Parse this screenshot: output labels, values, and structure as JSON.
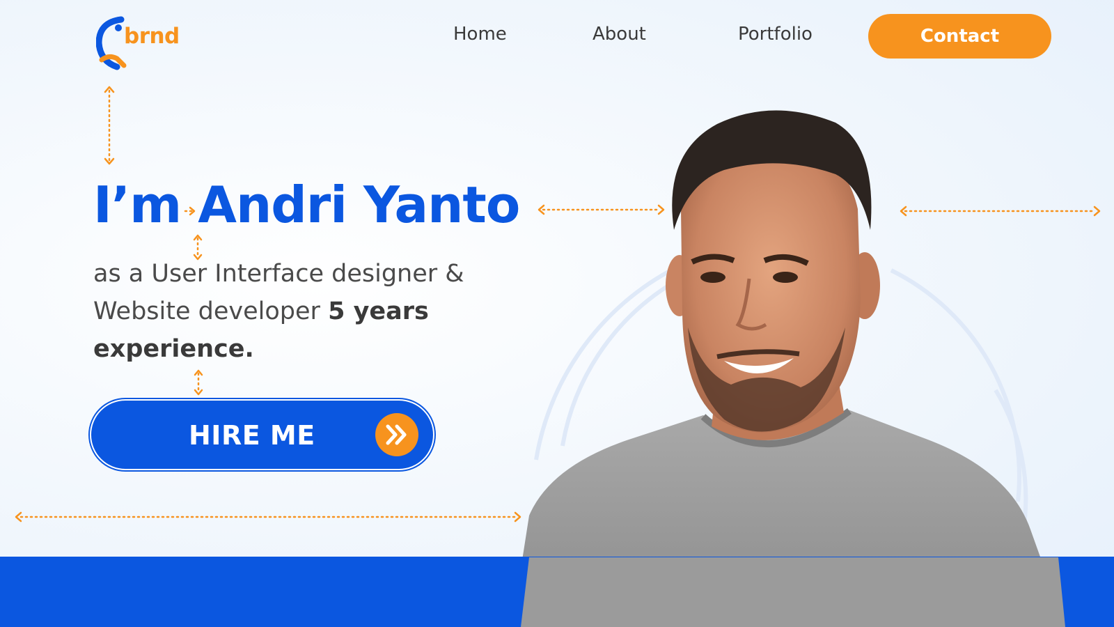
{
  "logo": {
    "text": "brnd",
    "icon": "hands-circle-logo-icon"
  },
  "nav": {
    "home": "Home",
    "about": "About",
    "portfolio": "Portfolio",
    "contact": "Contact"
  },
  "hero": {
    "intro": "I’m",
    "name": "Andri Yanto",
    "line1": "as a User Interface designer &",
    "line2": "Website developer",
    "highlight1": "5 years",
    "highlight2": "experience.",
    "cta": "HIRE ME",
    "cta_icon": "double-chevron-right-icon"
  },
  "colors": {
    "brand_blue": "#0b57e0",
    "accent_orange": "#f7931e",
    "text_dark": "#3a3a3a",
    "background": "#eef5fc"
  }
}
